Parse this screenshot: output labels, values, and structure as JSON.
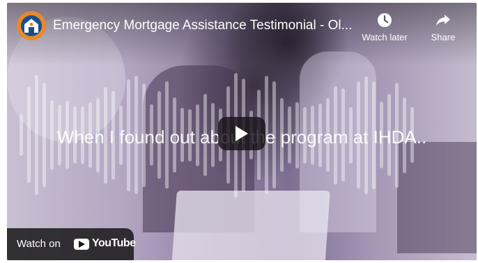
{
  "video": {
    "title": "Emergency Mortgage Assistance Testimonial - Ol...",
    "caption": "When I found out about the program at IHDA.."
  },
  "actions": {
    "watch_later_label": "Watch later",
    "share_label": "Share"
  },
  "footer": {
    "watch_on_label": "Watch on",
    "youtube_label": "YouTube"
  },
  "colors": {
    "avatar_ring": "#e8892a",
    "avatar_fill": "#1b4f8c",
    "overlay_tint": "#8f7fa3"
  },
  "icons": {
    "avatar": "channel-logo-house-icon",
    "watch_later": "clock-icon",
    "share": "share-arrow-icon",
    "play": "play-icon",
    "youtube": "youtube-logo-icon"
  }
}
